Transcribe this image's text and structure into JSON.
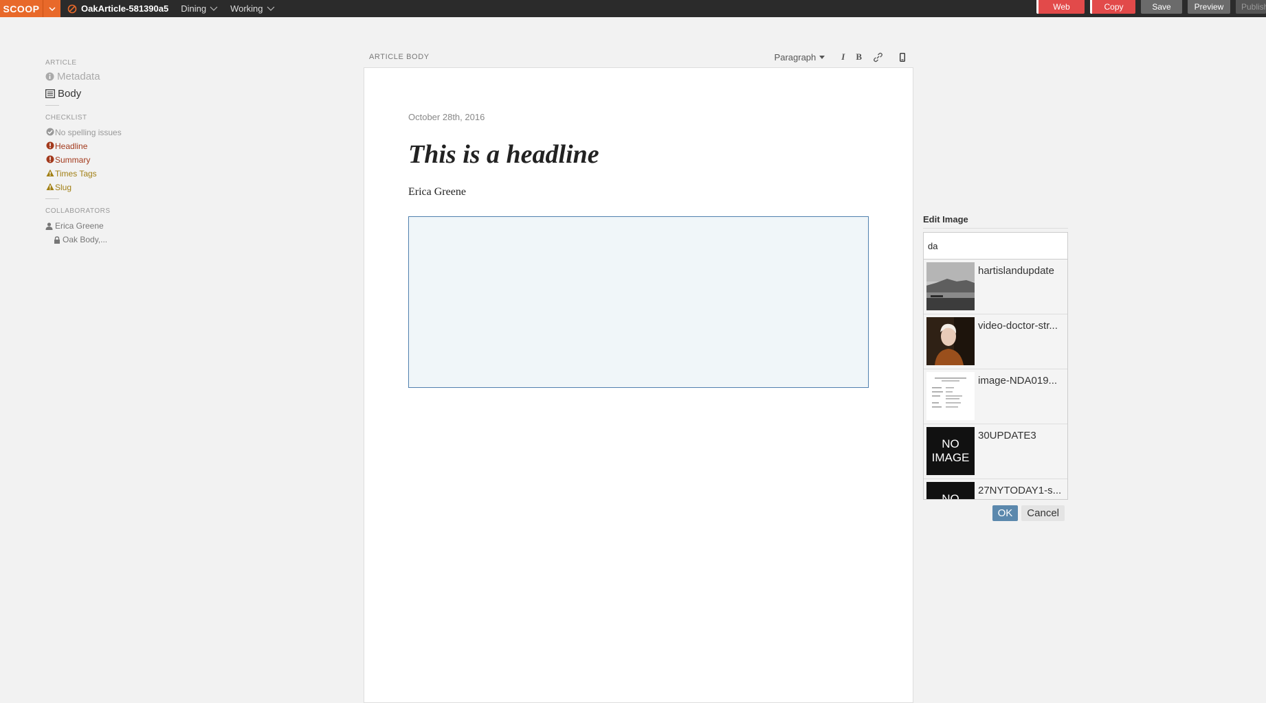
{
  "topbar": {
    "logo": "SCOOP",
    "doc_title": "OakArticle-581390a5",
    "menus": [
      "Dining",
      "Working"
    ],
    "actions": [
      "Web",
      "Copy",
      "Save",
      "Preview",
      "Publish"
    ]
  },
  "sidebar": {
    "article_head": "ARTICLE",
    "metadata": "Metadata",
    "body": "Body",
    "checklist_head": "CHECKLIST",
    "checklist": [
      {
        "label": "No spelling issues",
        "status": "ok"
      },
      {
        "label": "Headline",
        "status": "error"
      },
      {
        "label": "Summary",
        "status": "error"
      },
      {
        "label": "Times Tags",
        "status": "warning"
      },
      {
        "label": "Slug",
        "status": "warning"
      }
    ],
    "collaborators_head": "COLLABORATORS",
    "collaborators": [
      "Erica Greene",
      "Oak Body,..."
    ]
  },
  "editor": {
    "label": "ARTICLE BODY",
    "block_style": "Paragraph",
    "italic": "I",
    "bold": "B",
    "date": "October 28th, 2016",
    "headline": "This is a headline",
    "byline": "Erica Greene"
  },
  "edit_image": {
    "title": "Edit Image",
    "query": "da",
    "results": [
      {
        "name": "hartislandupdate",
        "thumb": "photo-landscape"
      },
      {
        "name": "video-doctor-str...",
        "thumb": "photo-portrait"
      },
      {
        "name": "image-NDA019...",
        "thumb": "document"
      },
      {
        "name": "30UPDATE3",
        "thumb": "no-image"
      },
      {
        "name": "27NYTODAY1-s...",
        "thumb": "no-image"
      }
    ],
    "no_image_line1": "NO",
    "no_image_line2": "IMAGE",
    "ok": "OK",
    "cancel": "Cancel"
  },
  "colors": {
    "accent": "#e8692a",
    "error": "#a33a1d",
    "warning": "#a17f13",
    "ok_button": "#5b88ad",
    "red_button": "#e24a4a"
  }
}
